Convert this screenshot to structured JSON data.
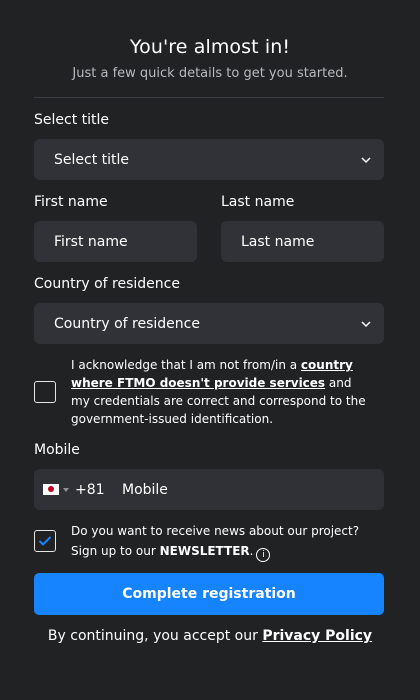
{
  "header": {
    "title": "You're almost in!",
    "subtitle": "Just a few quick details to get you started."
  },
  "form": {
    "title_label": "Select title",
    "title_select_value": "Select title",
    "first_name_label": "First name",
    "first_name_placeholder": "First name",
    "last_name_label": "Last name",
    "last_name_placeholder": "Last name",
    "country_label": "Country of residence",
    "country_select_value": "Country of residence",
    "acknowledge": {
      "text_before": "I acknowledge that I am not from/in a ",
      "link_text": "country where FTMO doesn't provide services",
      "text_after": " and my credentials are correct and correspond to the government-issued identification.",
      "checked": false
    },
    "mobile_label": "Mobile",
    "mobile_country_code": "+81",
    "mobile_country_flag": "japan-flag",
    "mobile_placeholder": "Mobile",
    "newsletter": {
      "text_before": "Do you want to receive news about our project? Sign up to our ",
      "strong_text": "NEWSLETTER",
      "text_after": ".",
      "checked": true
    },
    "submit_label": "Complete registration"
  },
  "footer": {
    "text_before": "By continuing, you accept our ",
    "link_text": "Privacy Policy"
  },
  "colors": {
    "background": "#202224",
    "field": "#303237",
    "accent": "#1784ff",
    "check": "#1784ff"
  }
}
